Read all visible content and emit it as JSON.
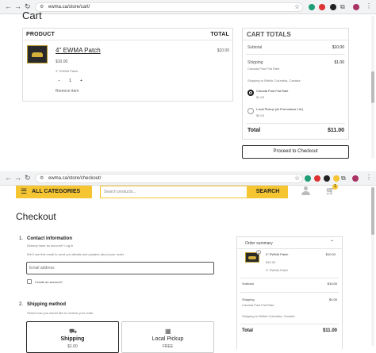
{
  "browser1": {
    "url": "ewma.ca/store/cart/"
  },
  "browser2": {
    "url": "ewma.ca/store/checkout/"
  },
  "cart": {
    "page_title": "Cart",
    "columns": {
      "product": "PRODUCT",
      "total": "TOTAL"
    },
    "item": {
      "name": "4\" EWMA Patch",
      "price": "$10.00",
      "detail": "4\" EWMA Patch",
      "quantity": "1",
      "remove": "Remove item",
      "total": "$10.00"
    },
    "totals": {
      "title": "CART TOTALS",
      "subtotal_label": "Subtotal",
      "subtotal_value": "$10.00",
      "shipping_label": "Shipping",
      "shipping_value": "$1.00",
      "shipping_method": "Canada Post Flat Rate",
      "shipping_to": "Shipping to British Columbia, Canada",
      "options": [
        {
          "label": "Canada Post Flat Rate",
          "price": "$1.00",
          "selected": true
        },
        {
          "label": "Local Pickup (At Promotions Ltd.)",
          "price": "$0.00",
          "selected": false
        }
      ],
      "total_label": "Total",
      "total_value": "$11.00",
      "checkout_button": "Proceed to Checkout"
    }
  },
  "store_header": {
    "categories_label": "ALL CATEGORIES",
    "search_placeholder": "Search products...",
    "search_button": "SEARCH",
    "cart_count": "1"
  },
  "checkout": {
    "title": "Checkout",
    "step1": {
      "number": "1.",
      "title": "Contact information",
      "login_prompt": "Already have an account? Log in",
      "note": "We'll use this email to send you details and updates about your order.",
      "email_placeholder": "Email address",
      "create_account": "Create an account?"
    },
    "step2": {
      "number": "2.",
      "title": "Shipping method",
      "note": "Select how you would like to receive your order.",
      "options": [
        {
          "label": "Shipping",
          "price": "$1.00"
        },
        {
          "label": "Local Pickup",
          "price": "FREE"
        }
      ]
    },
    "summary": {
      "title": "Order summary",
      "item_name": "4\" EWMA Patch",
      "item_price": "$10.00",
      "item_unit": "$10.00",
      "item_detail": "4\" EWMA Patch",
      "item_qty": "1",
      "subtotal_label": "Subtotal",
      "subtotal_value": "$10.00",
      "shipping_label": "Shipping",
      "shipping_value": "$1.00",
      "shipping_method": "Canada Post Flat Rate",
      "shipping_to": "Shipping to British Columbia, Canada",
      "total_label": "Total",
      "total_value": "$11.00"
    }
  },
  "colors": {
    "accent": "#f5c532",
    "badge": "#e94b3c"
  }
}
